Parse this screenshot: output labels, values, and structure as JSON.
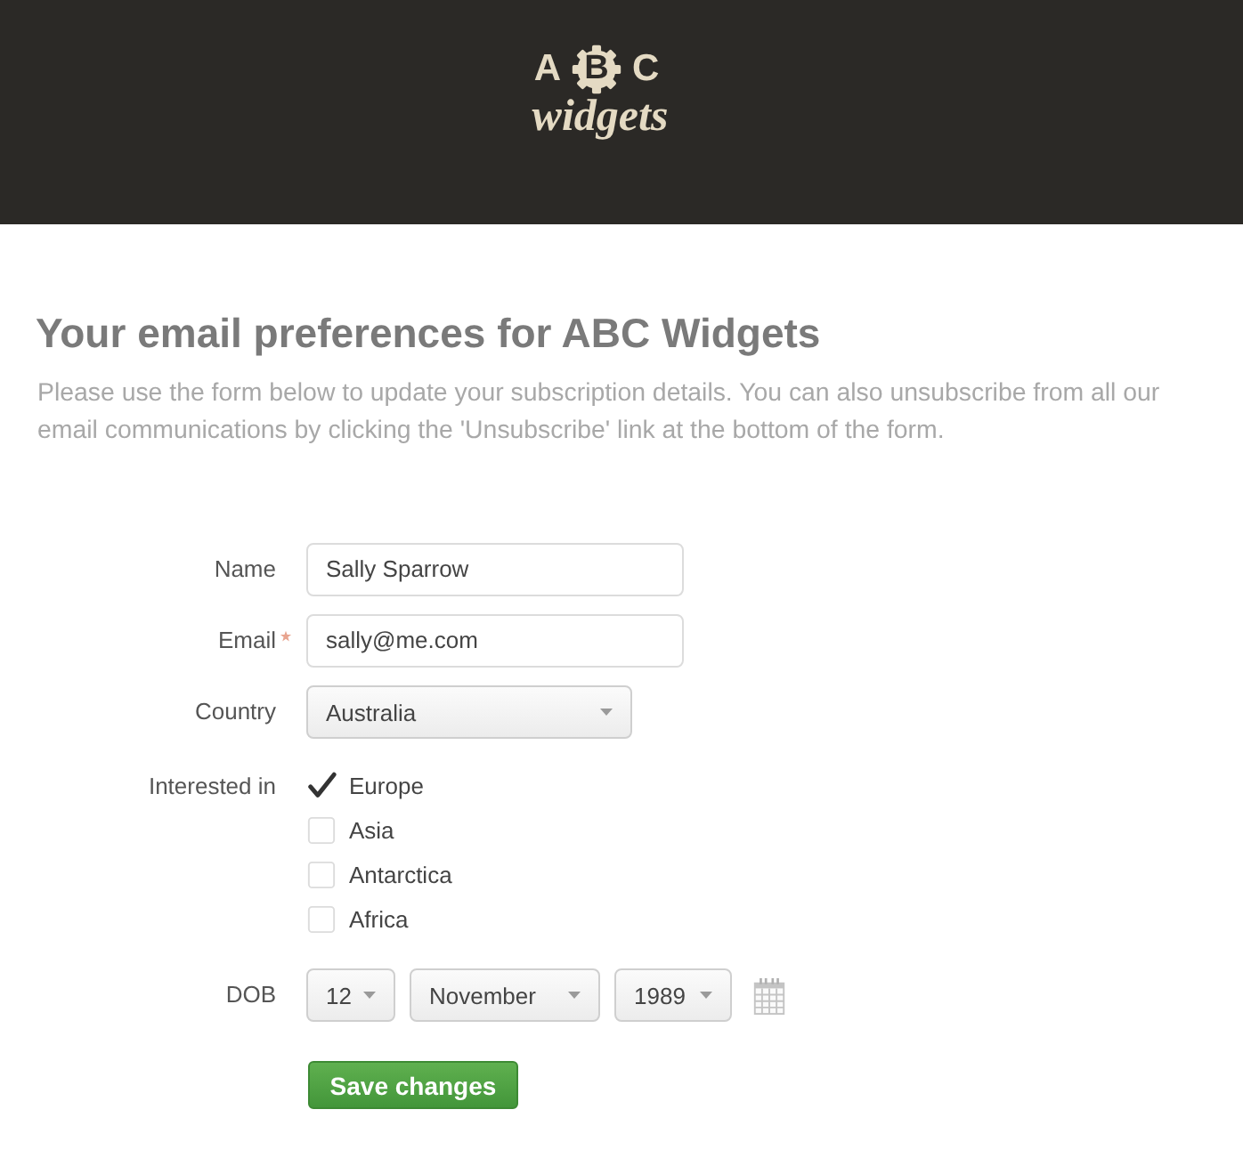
{
  "header": {
    "logo": {
      "letters": [
        {
          "text": "A",
          "on_gear": false
        },
        {
          "text": "B",
          "on_gear": true
        },
        {
          "text": "C",
          "on_gear": false
        }
      ],
      "word": "widgets"
    }
  },
  "page": {
    "title": "Your email preferences for ABC Widgets",
    "intro": "Please use the form below to update your subscription details. You can also unsubscribe from all our email communications by clicking the 'Unsubscribe' link at the bottom of the form."
  },
  "form": {
    "fields": [
      {
        "kind": "text",
        "label": "Name",
        "required": false,
        "value": "Sally Sparrow"
      },
      {
        "kind": "text",
        "label": "Email",
        "required": true,
        "value": "sally@me.com"
      },
      {
        "kind": "select",
        "label": "Country",
        "required": false,
        "value": "Australia"
      },
      {
        "kind": "checkboxes",
        "label": "Interested in",
        "required": false,
        "options": [
          {
            "label": "Europe",
            "checked": true
          },
          {
            "label": "Asia",
            "checked": false
          },
          {
            "label": "Antarctica",
            "checked": false
          },
          {
            "label": "Africa",
            "checked": false
          }
        ]
      },
      {
        "kind": "date",
        "label": "DOB",
        "required": false,
        "parts": [
          "12",
          "November",
          "1989"
        ]
      }
    ],
    "submit": "Save changes"
  }
}
